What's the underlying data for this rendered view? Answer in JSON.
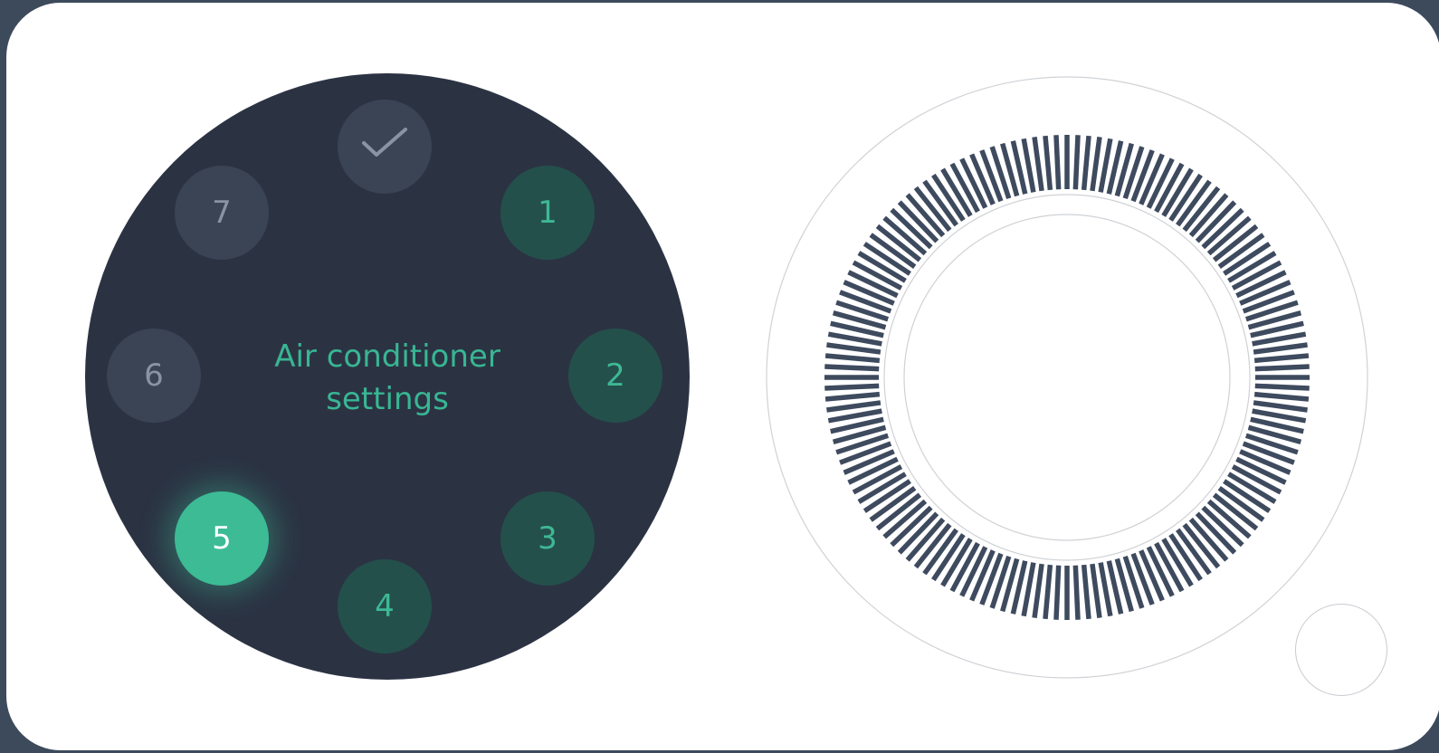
{
  "screen": {
    "title": "Air conditioner settings"
  },
  "options": [
    {
      "id": "confirm",
      "label": "",
      "icon": "check-icon",
      "state": "grey"
    },
    {
      "id": "1",
      "label": "1",
      "state": "green"
    },
    {
      "id": "2",
      "label": "2",
      "state": "green"
    },
    {
      "id": "3",
      "label": "3",
      "state": "green"
    },
    {
      "id": "4",
      "label": "4",
      "state": "green"
    },
    {
      "id": "5",
      "label": "5",
      "state": "active"
    },
    {
      "id": "6",
      "label": "6",
      "state": "grey"
    },
    {
      "id": "7",
      "label": "7",
      "state": "grey"
    }
  ],
  "colors": {
    "frame": "#3c4a5c",
    "watch_face": "#2b3343",
    "accent": "#3cbb95",
    "tick": "#3e4a5e"
  }
}
